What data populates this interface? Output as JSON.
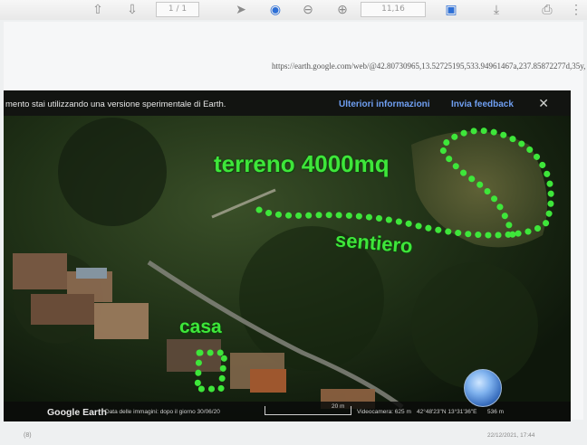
{
  "toolbar": {
    "page_field": "1 / 1",
    "zoom_field": "11,16"
  },
  "url": "https://earth.google.com/web/@42.80730965,13.52725195,533.94961467a,237.85872277d,35y,",
  "banner": {
    "text": "mento stai utilizzando una versione sperimentale di Earth.",
    "more_info": "Ulteriori informazioni",
    "feedback": "Invia feedback",
    "close": "✕"
  },
  "annotations": {
    "terrain": "terreno 4000mq",
    "path": "sentiero",
    "house": "casa"
  },
  "status_bar": {
    "logo": "Google Earth",
    "imagery_date": "Data delle immagini: dopo il giorno 30/06/20",
    "scale": "20 m",
    "camera": "Videocamera: 625 m",
    "coordinates": "42°48'23\"N 13°31'36\"E",
    "elevation": "536 m"
  },
  "footer": {
    "left": "(8)",
    "right": "22/12/2021, 17:44"
  },
  "colors": {
    "annotation_green": "#3ee63a",
    "link_blue": "#6f9ff2"
  }
}
